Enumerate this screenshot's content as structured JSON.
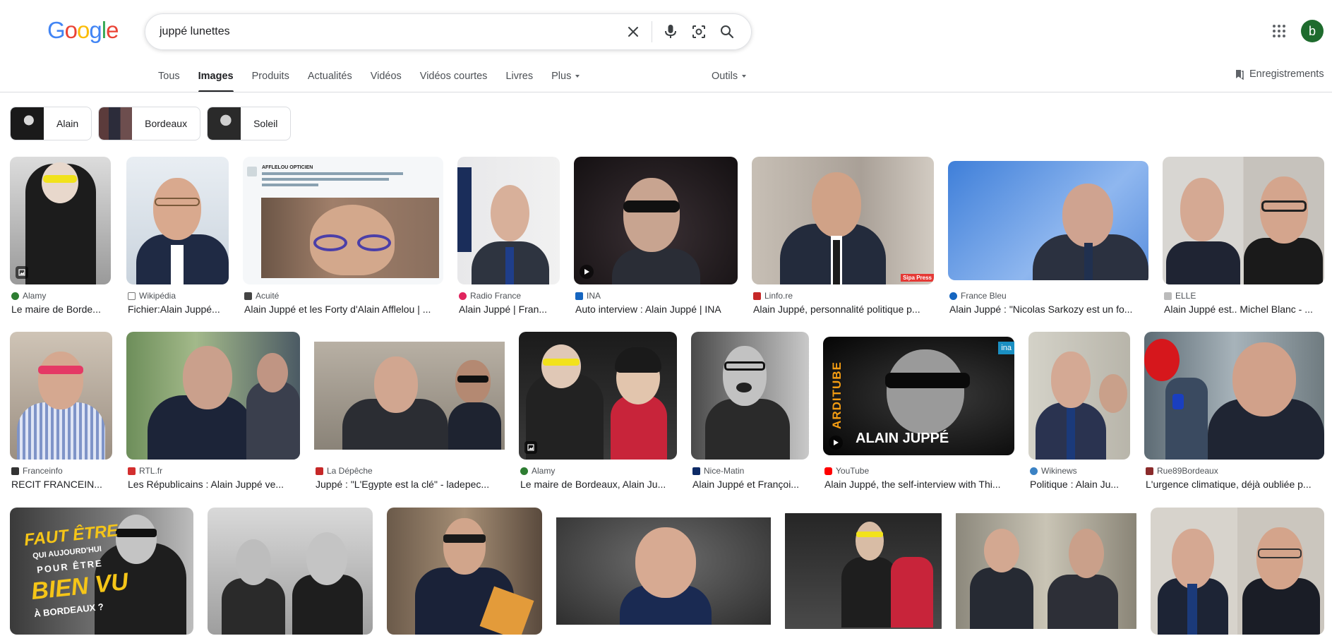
{
  "logo": {
    "letters": [
      "G",
      "o",
      "o",
      "g",
      "l",
      "e"
    ],
    "colors": [
      "#4285F4",
      "#EA4335",
      "#FBBC05",
      "#4285F4",
      "#34A853",
      "#EA4335"
    ]
  },
  "search": {
    "query": "juppé lunettes"
  },
  "icons": {
    "clear": "close-icon",
    "voice": "microphone-icon",
    "lens": "camera-lens-icon",
    "search": "search-icon",
    "apps": "apps-grid-icon"
  },
  "account": {
    "initial": "b",
    "color": "#1e6b2d"
  },
  "tabs": [
    {
      "label": "Tous",
      "active": false
    },
    {
      "label": "Images",
      "active": true
    },
    {
      "label": "Produits",
      "active": false
    },
    {
      "label": "Actualités",
      "active": false
    },
    {
      "label": "Vidéos",
      "active": false
    },
    {
      "label": "Vidéos courtes",
      "active": false
    },
    {
      "label": "Livres",
      "active": false
    },
    {
      "label": "Plus",
      "active": false
    }
  ],
  "tools_label": "Outils",
  "saved_label": "Enregistrements",
  "chips": [
    {
      "label": "Alain"
    },
    {
      "label": "Bordeaux"
    },
    {
      "label": "Soleil"
    }
  ],
  "results": [
    {
      "source": "Alamy",
      "title": "Le maire de Borde...",
      "fav": "#2e7d32"
    },
    {
      "source": "Wikipédia",
      "title": "Fichier:Alain Juppé...",
      "fav": "#555555"
    },
    {
      "source": "Acuité",
      "title": "Alain Juppé et les Forty d'Alain Afflelou | ...",
      "fav": "#444444"
    },
    {
      "source": "Radio France",
      "title": "Alain Juppé | Fran...",
      "fav": "#e0245e"
    },
    {
      "source": "INA",
      "title": "Auto interview : Alain Juppé | INA",
      "fav": "#1565c0"
    },
    {
      "source": "Linfo.re",
      "title": "Alain Juppé, personnalité politique p...",
      "fav": "#c62828"
    },
    {
      "source": "France Bleu",
      "title": "Alain Juppé : \"Nicolas Sarkozy est un fo...",
      "fav": "#1565c0"
    },
    {
      "source": "ELLE",
      "title": "Alain Juppé est.. Michel Blanc - ...",
      "fav": "#999999"
    },
    {
      "source": "Franceinfo",
      "title": "RECIT FRANCEIN...",
      "fav": "#333333"
    },
    {
      "source": "RTL.fr",
      "title": "Les Républicains : Alain Juppé ve...",
      "fav": "#d32f2f"
    },
    {
      "source": "La Dépêche",
      "title": "Juppé : \"L'Egypte est la clé\" - ladepec...",
      "fav": "#c62828"
    },
    {
      "source": "Alamy",
      "title": "Le maire de Bordeaux, Alain Ju...",
      "fav": "#2e7d32"
    },
    {
      "source": "Nice-Matin",
      "title": "Alain Juppé et Françoi...",
      "fav": "#0d2a66"
    },
    {
      "source": "YouTube",
      "title": "Alain Juppé, the self-interview with Thi...",
      "fav": "#ff0000"
    },
    {
      "source": "Wikinews",
      "title": "Politique : Alain Ju...",
      "fav": "#3b82c4"
    },
    {
      "source": "Rue89Bordeaux",
      "title": "L'urgence climatique, déjà oubliée p...",
      "fav": "#8a2b2b"
    }
  ],
  "image_texts": {
    "tweet_author": "AFFLELOU OPTICIEN",
    "ina_logo": "ina",
    "yt_side": "ARDITUBE",
    "yt_name": "ALAIN JUPPÉ",
    "poster_1": "FAUT ÊTRE",
    "poster_2": "QUI AUJOURD'HUI",
    "poster_3": "POUR ÊTRE",
    "poster_4": "BIEN VU",
    "poster_5": "À BORDEAUX ?",
    "sipa": "Sipa Press"
  }
}
